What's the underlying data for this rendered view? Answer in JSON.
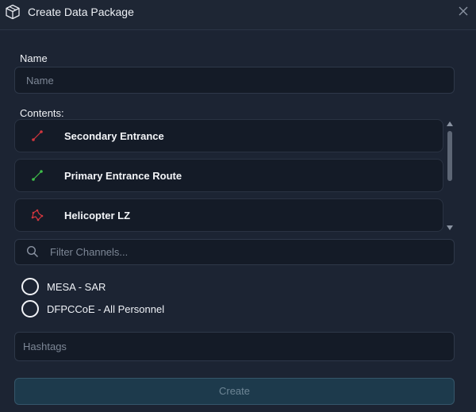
{
  "dialog": {
    "title": "Create Data Package",
    "title_icon": "package-cube-icon",
    "close_icon": "close-icon"
  },
  "name": {
    "label": "Name",
    "placeholder": "Name",
    "value": ""
  },
  "contents": {
    "label": "Contents:",
    "items": [
      {
        "label": "Secondary Entrance",
        "icon": "route-line-icon",
        "color": "#d2363e"
      },
      {
        "label": "Primary Entrance Route",
        "icon": "route-line-icon",
        "color": "#3fbf4a"
      },
      {
        "label": "Helicopter LZ",
        "icon": "polygon-area-icon",
        "color": "#d2363e"
      }
    ]
  },
  "channels": {
    "filter_placeholder": "Filter Channels...",
    "filter_icon": "search-icon",
    "options": [
      {
        "label": "MESA - SAR",
        "selected": false
      },
      {
        "label": "DFPCCoE - All Personnel",
        "selected": false
      }
    ]
  },
  "hashtags": {
    "placeholder": "Hashtags",
    "value": ""
  },
  "actions": {
    "create_label": "Create"
  },
  "colors": {
    "background": "#1c2433",
    "field_bg": "#141b27",
    "button_bg": "#1d3a4c",
    "button_text": "#6e8696"
  }
}
